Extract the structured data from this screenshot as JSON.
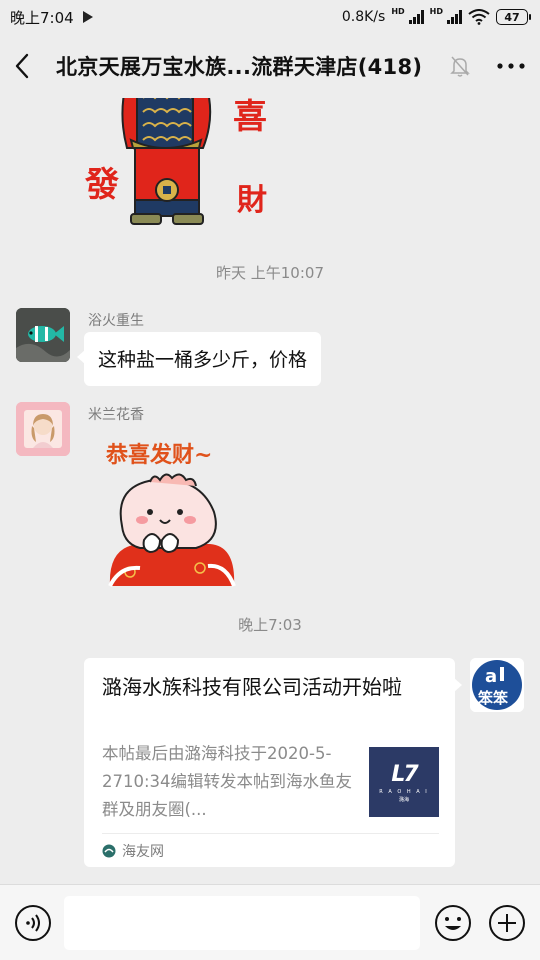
{
  "status_bar": {
    "time": "晚上7:04",
    "network_speed": "0.8K/s",
    "hd1": "HD",
    "hd2": "HD",
    "battery": "47"
  },
  "header": {
    "title": "北京天展万宝水族...流群天津店(418)"
  },
  "sticker1_text": {
    "left": "發",
    "right_top": "喜",
    "right_bottom": "財"
  },
  "messages": {
    "timestamp1": "昨天 上午10:07",
    "msg1": {
      "sender": "浴火重生",
      "text": "这种盐一桶多少斤，价格"
    },
    "msg2": {
      "sender": "米兰花香",
      "sticker_text": "恭喜发财~"
    },
    "timestamp2": "晚上7:03",
    "card": {
      "title": "潞海水族科技有限公司活动开始啦",
      "description": "本帖最后由潞海科技于2020-5-2710:34编辑转发本帖到海水鱼友群及朋友圈(...",
      "thumb_logo": "L7",
      "thumb_sub": "R A O H A I",
      "thumb_sub2": "潞海",
      "source": "海友网"
    },
    "right_avatar_text": "笨笨"
  },
  "colors": {
    "background": "#ededed",
    "bubble": "#ffffff",
    "timestamp": "#8a8a8a",
    "accent_red": "#e0251b"
  },
  "icons": [
    "back-arrow-icon",
    "mute-bell-icon",
    "more-icon",
    "voice-icon",
    "emoji-icon",
    "plus-icon",
    "play-icon",
    "wifi-icon",
    "source-logo-icon"
  ]
}
